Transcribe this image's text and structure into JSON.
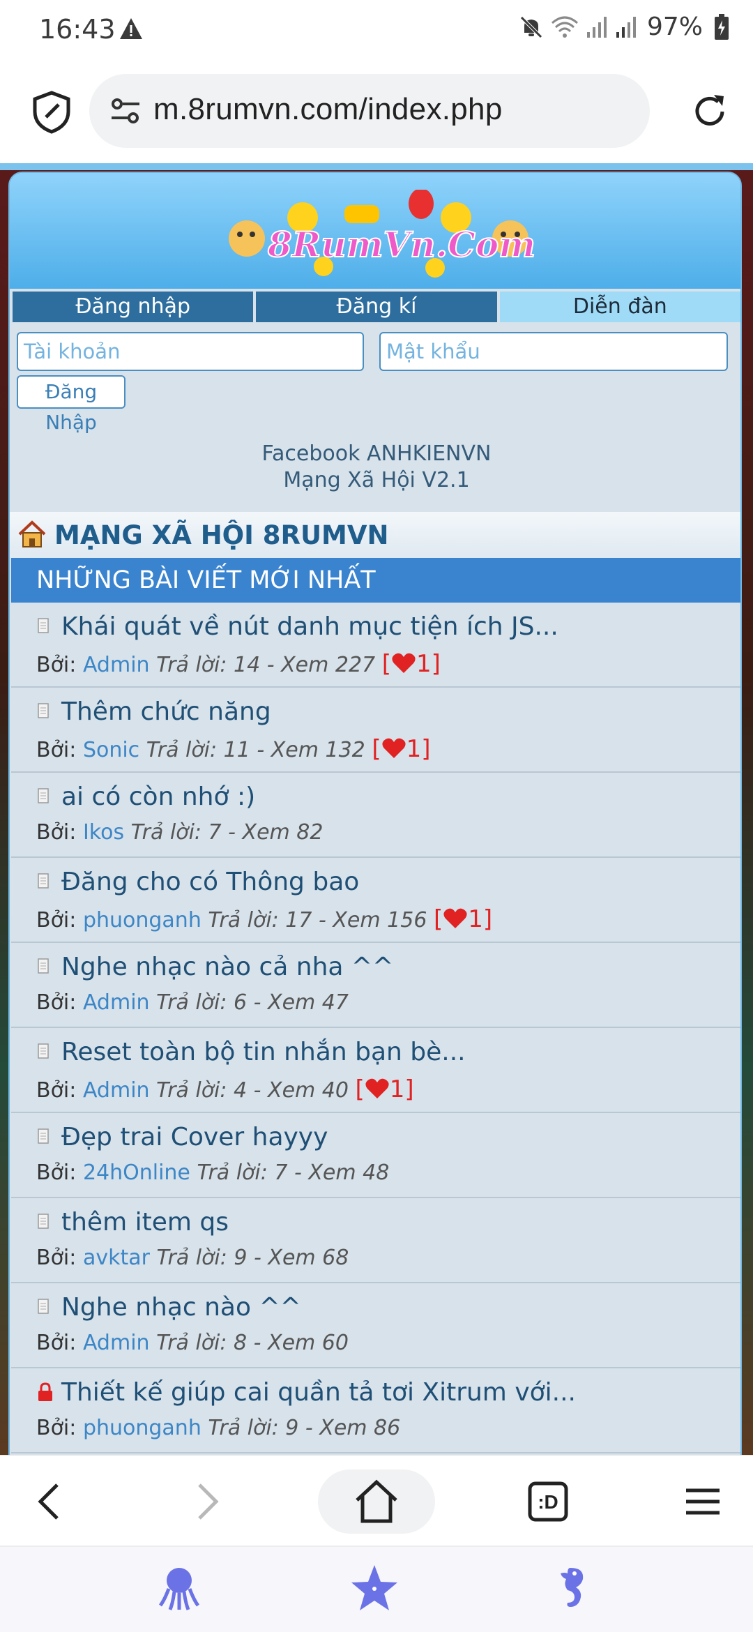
{
  "status_bar": {
    "time": "16:43",
    "battery": "97%"
  },
  "browser": {
    "url": "m.8rumvn.com/index.php"
  },
  "site": {
    "logo_text": "8RumVn.Com",
    "tabs": [
      {
        "label": "Đăng nhập",
        "active": false
      },
      {
        "label": "Đăng kí",
        "active": false
      },
      {
        "label": "Diễn đàn",
        "active": true
      }
    ],
    "login": {
      "username_placeholder": "Tài khoản",
      "password_placeholder": "Mật khẩu",
      "submit_label": "Đăng Nhập"
    },
    "info_line1": "Facebook ANHKIENVN",
    "info_line2": "Mạng Xã Hội V2.1",
    "title": "MẠNG XÃ HỘI 8RUMVN",
    "section_header": "NHỮNG BÀI VIẾT MỚI NHẤT"
  },
  "posts": [
    {
      "title": "Khái quát về nút danh mục tiện ích JS...",
      "by": "Bởi:",
      "author": "Admin",
      "stats": "Trả lời: 14 - Xem 227",
      "likes_open": "[",
      "likes_count": "1]",
      "locked": false
    },
    {
      "title": "Thêm chức năng",
      "by": "Bởi:",
      "author": "Sonic",
      "stats": "Trả lời: 11 - Xem 132",
      "likes_open": "[",
      "likes_count": "1]",
      "locked": false
    },
    {
      "title": "ai có còn nhớ :)",
      "by": "Bởi:",
      "author": "Ikos",
      "stats": "Trả lời: 7 - Xem 82",
      "locked": false
    },
    {
      "title": "Đăng cho có Thông bao",
      "by": "Bởi:",
      "author": "phuonganh",
      "stats": "Trả lời: 17 - Xem 156",
      "likes_open": "[",
      "likes_count": "1]",
      "locked": false
    },
    {
      "title": "Nghe nhạc nào cả nha ^^",
      "by": "Bởi:",
      "author": "Admin",
      "stats": "Trả lời: 6 - Xem 47",
      "locked": false
    },
    {
      "title": "Reset toàn bộ tin nhắn bạn bè...",
      "by": "Bởi:",
      "author": "Admin",
      "stats": "Trả lời: 4 - Xem 40",
      "likes_open": "[",
      "likes_count": "1]",
      "locked": false
    },
    {
      "title": "Đẹp trai Cover hayyy",
      "by": "Bởi:",
      "author": "24hOnline",
      "stats": "Trả lời: 7 - Xem 48",
      "locked": false
    },
    {
      "title": "thêm item qs",
      "by": "Bởi:",
      "author": "avktar",
      "stats": "Trả lời: 9 - Xem 68",
      "locked": false
    },
    {
      "title": "Nghe nhạc nào ^^",
      "by": "Bởi:",
      "author": "Admin",
      "stats": "Trả lời: 8 - Xem 60",
      "locked": false
    },
    {
      "title": "Thiết kế giúp cai quần tả tơi Xitrum với...",
      "by": "Bởi:",
      "author": "phuonganh",
      "stats": "Trả lời: 9 - Xem 86",
      "locked": true
    }
  ],
  "toolbar": {
    "tabs_label": ":D"
  },
  "colors": {
    "accent": "#3a84cf",
    "link": "#3d86c6",
    "like": "#e02222",
    "card_bg": "#d7e2eb"
  }
}
